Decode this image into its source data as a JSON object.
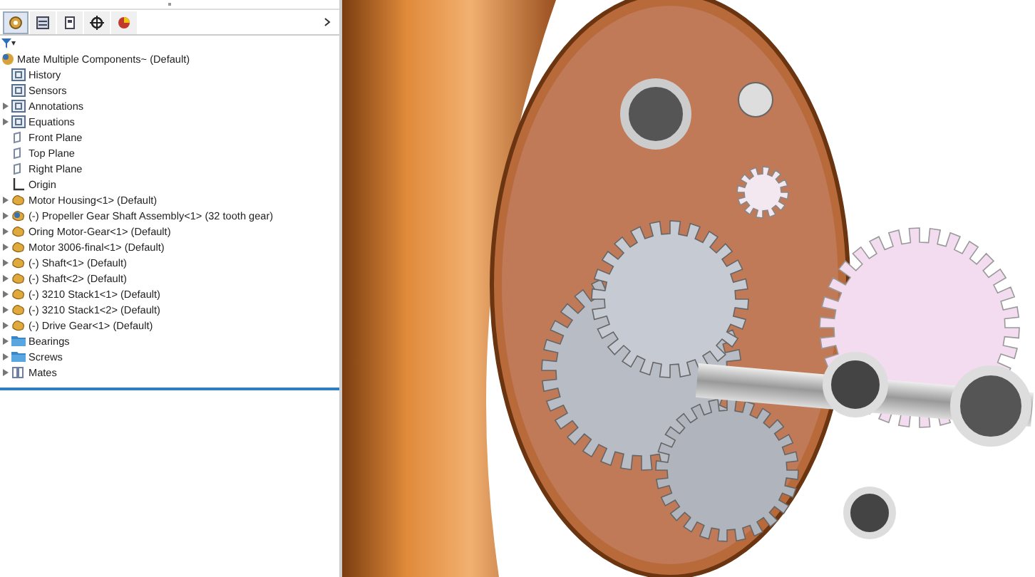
{
  "tabs": [
    {
      "kind": "feature",
      "selected": true
    },
    {
      "kind": "property",
      "selected": false
    },
    {
      "kind": "config",
      "selected": false
    },
    {
      "kind": "dim",
      "selected": false
    },
    {
      "kind": "display",
      "selected": false
    }
  ],
  "filter": {
    "caret": "▾"
  },
  "tree": {
    "root": {
      "label": "Mate Multiple Components~  (Default)"
    },
    "items": [
      {
        "label": "History",
        "kind": "history",
        "expandable": false
      },
      {
        "label": "Sensors",
        "kind": "sensor",
        "expandable": false
      },
      {
        "label": "Annotations",
        "kind": "annotation",
        "expandable": true
      },
      {
        "label": "Equations",
        "kind": "equation",
        "expandable": true
      },
      {
        "label": "Front Plane",
        "kind": "plane",
        "expandable": false
      },
      {
        "label": "Top Plane",
        "kind": "plane",
        "expandable": false
      },
      {
        "label": "Right Plane",
        "kind": "plane",
        "expandable": false
      },
      {
        "label": "Origin",
        "kind": "origin",
        "expandable": false
      },
      {
        "label": "Motor Housing<1> (Default)",
        "kind": "part",
        "expandable": true
      },
      {
        "label": "(-) Propeller Gear Shaft Assembly<1> (32 tooth gear)",
        "kind": "assembly",
        "expandable": true
      },
      {
        "label": "Oring Motor-Gear<1> (Default)",
        "kind": "part",
        "expandable": true
      },
      {
        "label": "Motor 3006-final<1> (Default)",
        "kind": "part",
        "expandable": true
      },
      {
        "label": "(-) Shaft<1> (Default)",
        "kind": "part",
        "expandable": true
      },
      {
        "label": "(-) Shaft<2> (Default)",
        "kind": "part",
        "expandable": true
      },
      {
        "label": "(-) 3210 Stack1<1> (Default)",
        "kind": "part",
        "expandable": true
      },
      {
        "label": "(-) 3210 Stack1<2> (Default)",
        "kind": "part",
        "expandable": true
      },
      {
        "label": "(-) Drive Gear<1> (Default)",
        "kind": "part",
        "expandable": true
      },
      {
        "label": "Bearings",
        "kind": "folder",
        "expandable": true
      },
      {
        "label": "Screws",
        "kind": "folder",
        "expandable": true
      },
      {
        "label": "Mates",
        "kind": "mates",
        "expandable": true
      }
    ]
  }
}
